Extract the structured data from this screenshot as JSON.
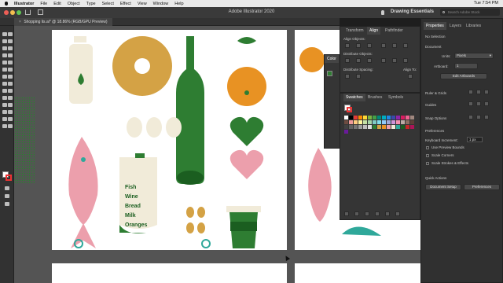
{
  "menubar": {
    "items": [
      "Illustrator",
      "File",
      "Edit",
      "Object",
      "Type",
      "Select",
      "Effect",
      "View",
      "Window",
      "Help"
    ],
    "clock": "Tue 7:54 PM"
  },
  "window": {
    "title": "Adobe Illustrator 2020"
  },
  "header": {
    "workspace": "Drawing Essentials",
    "search_placeholder": "Search Adobe Stock"
  },
  "document_tab": "Shopping lis.ai* @ 18.86% (RGB/GPU Preview)",
  "artwork": {
    "list": [
      "Fish",
      "Wine",
      "Bread",
      "Milk",
      "Oranges"
    ]
  },
  "align_panel": {
    "tabs": [
      "Transform",
      "Align",
      "Pathfinder"
    ],
    "active_tab": "Align",
    "align_objects": "Align Objects:",
    "distribute_objects": "Distribute Objects:",
    "distribute_spacing": "Distribute Spacing:",
    "align_to": "Align To:"
  },
  "color_panel": {
    "tab": "Color"
  },
  "swatches_panel": {
    "tabs": [
      "Swatches",
      "Brushes",
      "Symbols"
    ],
    "active_tab": "Swatches"
  },
  "properties_panel": {
    "tabs": [
      "Properties",
      "Layers",
      "Libraries"
    ],
    "active_tab": "Properties",
    "no_selection": "No Selection",
    "document": "Document",
    "units_label": "Units:",
    "units_value": "Pixels",
    "artboard_label": "Artboard:",
    "artboard_value": "1",
    "edit_artboards": "Edit Artboards",
    "rulers_grids": "Ruler & Grids",
    "guides": "Guides",
    "snap_options": "Snap Options",
    "preferences_section": "Preferences",
    "keyboard_increment_label": "Keyboard Increment:",
    "keyboard_increment_value": "1 px",
    "use_preview_bounds": "Use Preview Bounds",
    "scale_corners": "Scale Corners",
    "scale_strokes": "Scale Strokes & Effects",
    "quick_actions": "Quick Actions",
    "document_setup": "Document Setup",
    "preferences_button": "Preferences"
  },
  "colors": {
    "green": "#2e7d32",
    "ochre": "#d4a245",
    "orange": "#e89223",
    "pink": "#ec9fac",
    "cream": "#f1ebd9",
    "teal": "#2fa89a"
  }
}
